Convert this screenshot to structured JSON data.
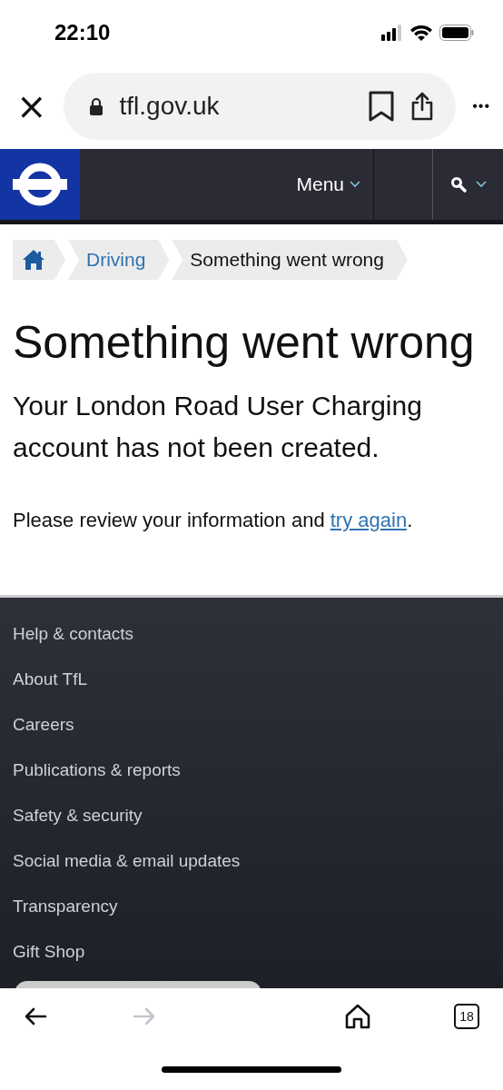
{
  "status_bar": {
    "time": "22:10"
  },
  "browser": {
    "close": "×",
    "url": "tfl.gov.uk",
    "more": "•••"
  },
  "site_header": {
    "menu": "Menu"
  },
  "breadcrumb": [
    {
      "kind": "home"
    },
    {
      "kind": "link",
      "label": "Driving"
    },
    {
      "kind": "current",
      "label": "Something went wrong"
    }
  ],
  "page": {
    "heading": "Something went wrong",
    "message": "Your London Road User Charging account has not been created.",
    "instruction": "Please review your information and ",
    "link": "try again",
    "end": "."
  },
  "footer": {
    "links": [
      "Help & contacts",
      "About TfL",
      "Careers",
      "Publications & reports",
      "Safety & security",
      "Social media & email updates",
      "Transparency",
      "Gift Shop"
    ]
  },
  "toolbar": {
    "back": {
      "disabled": false
    },
    "forward": {
      "disabled": true
    },
    "tabs": "18"
  }
}
